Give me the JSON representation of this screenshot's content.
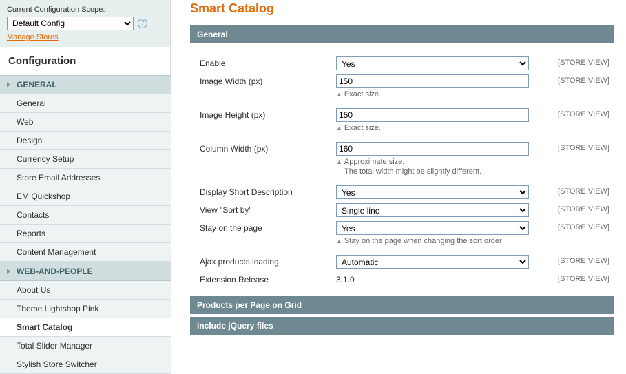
{
  "scope": {
    "label": "Current Configuration Scope:",
    "selected": "Default Config",
    "manage_link": "Manage Stores"
  },
  "sidebar": {
    "title": "Configuration",
    "sections": [
      {
        "name": "GENERAL",
        "items": [
          "General",
          "Web",
          "Design",
          "Currency Setup",
          "Store Email Addresses",
          "EM Quickshop",
          "Contacts",
          "Reports",
          "Content Management"
        ]
      },
      {
        "name": "WEB-AND-PEOPLE",
        "items": [
          "About Us",
          "Theme Lightshop Pink",
          "Smart Catalog",
          "Total Slider Manager",
          "Stylish Store Switcher"
        ]
      }
    ],
    "active": "Smart Catalog"
  },
  "page": {
    "title": "Smart Catalog",
    "scope_label": "[STORE VIEW]",
    "sections": {
      "general": {
        "title": "General",
        "fields": {
          "enable": {
            "label": "Enable",
            "value": "Yes"
          },
          "image_width": {
            "label": "Image Width (px)",
            "value": "150",
            "note": "Exact size."
          },
          "image_height": {
            "label": "Image Height (px)",
            "value": "150",
            "note": "Exact size."
          },
          "column_width": {
            "label": "Column Width (px)",
            "value": "160",
            "note": "Approximate size.",
            "note2": "The total width might be slightly different."
          },
          "short_desc": {
            "label": "Display Short Description",
            "value": "Yes"
          },
          "sort_by": {
            "label": "View \"Sort by\"",
            "value": "Single line"
          },
          "stay": {
            "label": "Stay on the page",
            "value": "Yes",
            "note": "Stay on the page when changing the sort order"
          },
          "ajax": {
            "label": "Ajax products loading",
            "value": "Automatic"
          },
          "release": {
            "label": "Extension Release",
            "value": "3.1.0"
          }
        }
      },
      "ppg": {
        "title": "Products per Page on Grid"
      },
      "jquery": {
        "title": "Include jQuery files"
      }
    }
  }
}
